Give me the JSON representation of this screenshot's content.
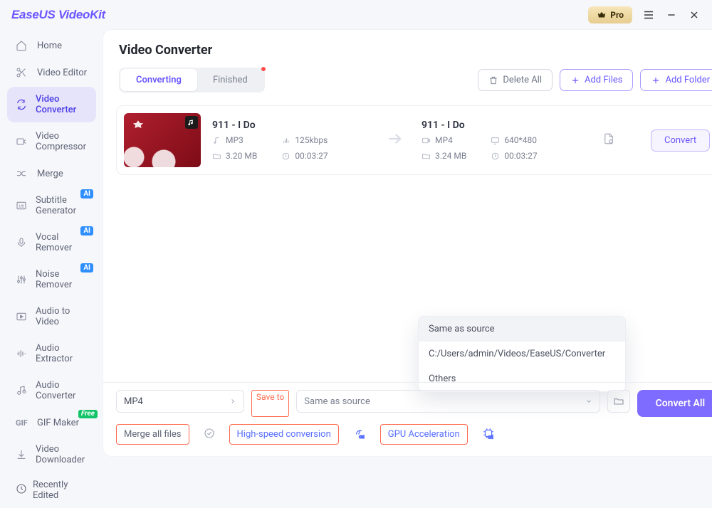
{
  "brand": "EaseUS VideoKit",
  "pro_label": "Pro",
  "sidebar": {
    "items": [
      {
        "label": "Home"
      },
      {
        "label": "Video Editor"
      },
      {
        "label": "Video Converter"
      },
      {
        "label": "Video Compressor"
      },
      {
        "label": "Merge"
      },
      {
        "label": "Subtitle Generator",
        "badge": "AI"
      },
      {
        "label": "Vocal Remover",
        "badge": "AI"
      },
      {
        "label": "Noise Remover",
        "badge": "AI"
      },
      {
        "label": "Audio to Video"
      },
      {
        "label": "Audio Extractor"
      },
      {
        "label": "Audio Converter"
      },
      {
        "label": "GIF Maker",
        "badge": "Free"
      },
      {
        "label": "Video Downloader"
      }
    ],
    "recently": "Recently Edited"
  },
  "page": {
    "title": "Video Converter",
    "tab_converting": "Converting",
    "tab_finished": "Finished",
    "delete_all": "Delete All",
    "add_files": "Add Files",
    "add_folder": "Add Folder"
  },
  "item": {
    "src_title": "911 - I Do",
    "src_format": "MP3",
    "src_bitrate": "125kbps",
    "src_size": "3.20 MB",
    "src_duration": "00:03:27",
    "dst_title": "911 - I Do",
    "dst_format": "MP4",
    "dst_res": "640*480",
    "dst_size": "3.24 MB",
    "dst_duration": "00:03:27",
    "convert": "Convert"
  },
  "footer": {
    "format_selected": "MP4",
    "save_to_label": "Save to",
    "save_to_value": "Same as source",
    "merge_all": "Merge all files",
    "high_speed": "High-speed conversion",
    "gpu": "GPU Acceleration",
    "convert_all": "Convert All"
  },
  "dropdown": {
    "opt1": "Same as source",
    "opt2": "C:/Users/admin/Videos/EaseUS/Converter",
    "opt3": "Others"
  }
}
